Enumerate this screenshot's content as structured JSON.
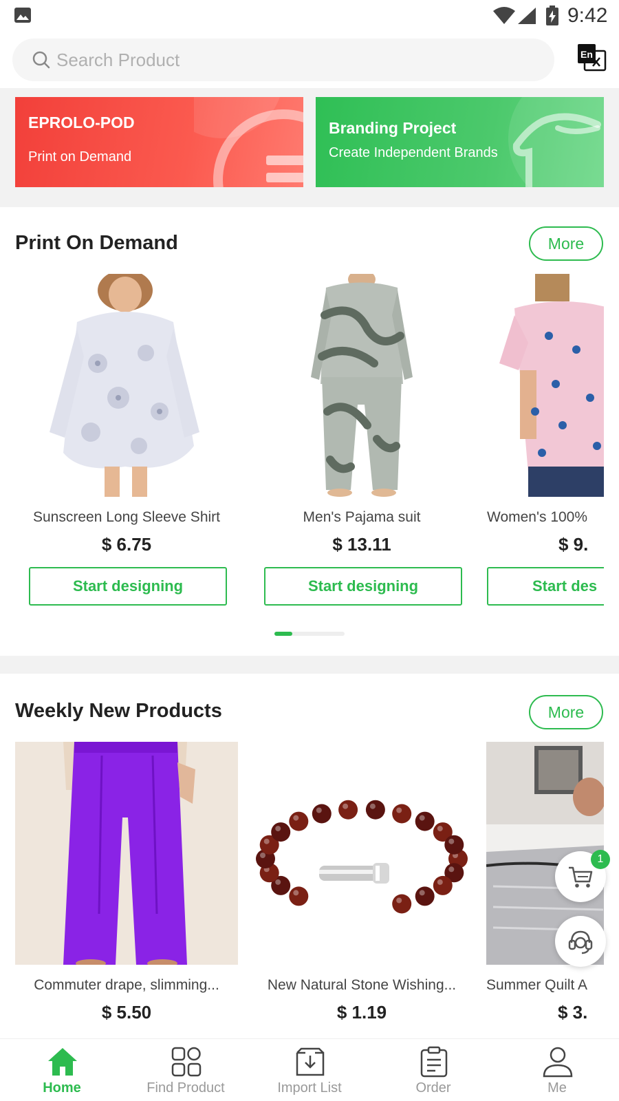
{
  "status_bar": {
    "time": "9:42",
    "icons": [
      "gallery-icon",
      "wifi-icon",
      "signal-icon",
      "battery-charging-icon"
    ]
  },
  "search": {
    "placeholder": "Search Product",
    "value": "",
    "icon": "search-icon"
  },
  "translate_button": {
    "icon": "translate-icon",
    "label": "En"
  },
  "banners": [
    {
      "title": "EPROLO-POD",
      "subtitle": "Print on Demand",
      "color": "#f2403a"
    },
    {
      "title": "Branding Project",
      "subtitle": "Create Independent Brands",
      "color": "#2fbf55"
    }
  ],
  "pod_section": {
    "title": "Print On Demand",
    "more_label": "More",
    "products": [
      {
        "name": "Sunscreen Long Sleeve Shirt",
        "price": "$ 6.75",
        "button": "Start designing"
      },
      {
        "name": "Men's Pajama suit",
        "price": "$ 13.11",
        "button": "Start designing"
      },
      {
        "name": "Women's 100%",
        "price": "$ 9.",
        "button": "Start des"
      }
    ]
  },
  "weekly_section": {
    "title": "Weekly New Products",
    "more_label": "More",
    "products": [
      {
        "name": "Commuter drape, slimming...",
        "price": "$ 5.50"
      },
      {
        "name": "New Natural Stone Wishing...",
        "price": "$ 1.19"
      },
      {
        "name": "Summer Quilt A",
        "price": "$ 3."
      }
    ]
  },
  "floating": {
    "cart_badge": "1",
    "icons": [
      "cart-icon",
      "support-headset-icon"
    ]
  },
  "bottom_nav": {
    "items": [
      {
        "label": "Home",
        "icon": "home-icon",
        "active": true
      },
      {
        "label": "Find Product",
        "icon": "grid-icon",
        "active": false
      },
      {
        "label": "Import List",
        "icon": "import-icon",
        "active": false
      },
      {
        "label": "Order",
        "icon": "clipboard-icon",
        "active": false
      },
      {
        "label": "Me",
        "icon": "person-icon",
        "active": false
      }
    ]
  },
  "colors": {
    "accent": "#2dbb4f",
    "banner_red": "#f2403a",
    "banner_green": "#2fbf55"
  }
}
